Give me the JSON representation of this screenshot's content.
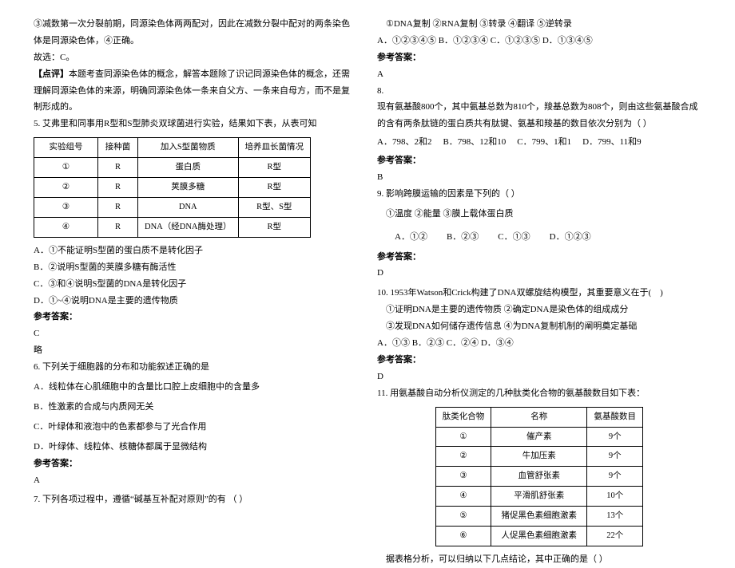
{
  "left": {
    "intro1": "③减数第一次分裂前期，同源染色体两两配对，因此在减数分裂中配对的两条染色体是同源染色体，④正确。",
    "intro2": "故选：C。",
    "comment_label": "【点评】",
    "comment": "本题考查同源染色体的概念，解答本题除了识记同源染色体的概念，还需理解同源染色体的来源，明确同源染色体一条来自父方、一条来自母方，而不是复制形成的。",
    "q5_stem": "5. 艾弗里和同事用R型和S型肺炎双球菌进行实验，结果如下表，从表可知",
    "q5_table": {
      "headers": [
        "实验组号",
        "接种菌",
        "加入S型菌物质",
        "培养皿长菌情况"
      ],
      "rows": [
        [
          "①",
          "R",
          "蛋白质",
          "R型"
        ],
        [
          "②",
          "R",
          "荚膜多糖",
          "R型"
        ],
        [
          "③",
          "R",
          "DNA",
          "R型、S型"
        ],
        [
          "④",
          "R",
          "DNA（经DNA酶处理）",
          "R型"
        ]
      ]
    },
    "q5_A": "A．①不能证明S型菌的蛋白质不是转化因子",
    "q5_B": "B．②说明S型菌的荚膜多糖有酶活性",
    "q5_C": "C．③和④说明S型菌的DNA是转化因子",
    "q5_D": "D．①~④说明DNA是主要的遗传物质",
    "ans_label": "参考答案：",
    "q5_ans": "C",
    "q5_note": "略",
    "q6_stem": "6. 下列关于细胞器的分布和功能叙述正确的是",
    "q6_A": "A．线粒体在心肌细胞中的含量比口腔上皮细胞中的含量多",
    "q6_B": "B．性激素的合成与内质网无关",
    "q6_C": "C．叶绿体和液泡中的色素都参与了光合作用",
    "q6_D": "D．叶绿体、线粒体、核糖体都属于显微结构",
    "q6_ans": "A",
    "q7_stem": "7. 下列各项过程中，遵循“碱基互补配对原则”的有    （   ）"
  },
  "right": {
    "q7_items": "①DNA复制    ②RNA复制    ③转录    ④翻译    ⑤逆转录",
    "q7_opts": "A．①②③④⑤ B．①②③④  C．①②③⑤  D．①③④⑤",
    "ans_label": "参考答案：",
    "q7_ans": "A",
    "q8_num": "8.",
    "q8_stem": "现有氨基酸800个，其中氨基总数为810个，羧基总数为808个，则由这些氨基酸合成的含有两条肽链的蛋白质共有肽键、氨基和羧基的数目依次分别为（   ）",
    "q8_A": "A．798、2和2",
    "q8_B": "B．798、12和10",
    "q8_C": "C．799、1和1",
    "q8_D": "D．799、11和9",
    "q8_ans": "B",
    "q9_stem": "9. 影响跨膜运输的因素是下列的（   ）",
    "q9_items": "①温度 ②能量 ③膜上载体蛋白质",
    "q9_A": "A．①②",
    "q9_B": "B．②③",
    "q9_C": "C．①③",
    "q9_D": "D．①②③",
    "q9_ans": "D",
    "q10_stem": "10. 1953年Watson和Crick构建了DNA双螺旋结构模型，其重要意义在于(　)",
    "q10_items1": "①证明DNA是主要的遗传物质   ②确定DNA是染色体的组成成分",
    "q10_items2": "③发现DNA如何储存遗传信息   ④为DNA复制机制的阐明奠定基础",
    "q10_opts": "A．①③     B．②③    C．②④    D．③④",
    "q10_ans": "D",
    "q11_stem": "11. 用氨基酸自动分析仪测定的几种肽类化合物的氨基酸数目如下表：",
    "q11_table": {
      "headers": [
        "肽类化合物",
        "名称",
        "氨基酸数目"
      ],
      "rows": [
        [
          "①",
          "催产素",
          "9个"
        ],
        [
          "②",
          "牛加压素",
          "9个"
        ],
        [
          "③",
          "血管舒张素",
          "9个"
        ],
        [
          "④",
          "平滑肌舒张素",
          "10个"
        ],
        [
          "⑤",
          "猪促黑色素细胞激素",
          "13个"
        ],
        [
          "⑥",
          "人促黑色素细胞激素",
          "22个"
        ]
      ]
    },
    "q11_tail": "据表格分析，可以归纳以下几点结论，其中正确的是（   ）"
  }
}
